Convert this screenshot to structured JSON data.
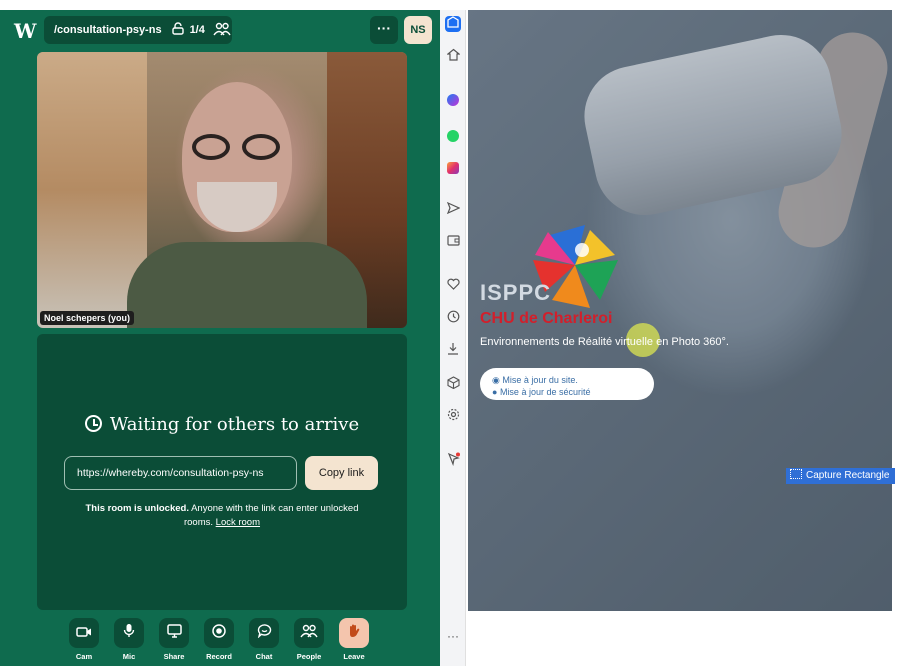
{
  "whereby": {
    "logo": "W",
    "room_path": "/consultation-psy-ns",
    "participant_count": "1/4",
    "more_label": "···",
    "avatar_initials": "NS",
    "self_name": "Noel schepers (you)",
    "waiting_title": "Waiting for others to arrive",
    "room_link": "https://whereby.com/consultation-psy-ns",
    "copy_link_label": "Copy link",
    "unlocked_bold": "This room is unlocked.",
    "unlocked_text": " Anyone with the link can enter unlocked rooms. ",
    "lock_room_label": "Lock room",
    "controls": [
      {
        "label": "Cam",
        "icon": "camera-icon"
      },
      {
        "label": "Mic",
        "icon": "mic-icon"
      },
      {
        "label": "Share",
        "icon": "screen-share-icon"
      },
      {
        "label": "Record",
        "icon": "record-icon"
      },
      {
        "label": "Chat",
        "icon": "chat-icon"
      },
      {
        "label": "People",
        "icon": "people-icon"
      },
      {
        "label": "Leave",
        "icon": "wave-icon"
      }
    ]
  },
  "browser_sidebar": {
    "more_label": "···"
  },
  "site": {
    "brand": "ISPPC",
    "hospital": "CHU de Charleroi",
    "tagline": "Environnements de Réalité virtuelle en Photo 360°.",
    "info_line_1": "Mise à jour du site.",
    "info_line_2": "Mise à jour de sécurité"
  },
  "capture_tooltip": "Capture Rectangle",
  "colors": {
    "whereby_green": "#0f6b4e",
    "whereby_dark_green": "#0b4d37",
    "cream": "#f4e4d0",
    "chu_red": "#d21f2b",
    "browser_accent": "#1d6ff2"
  }
}
